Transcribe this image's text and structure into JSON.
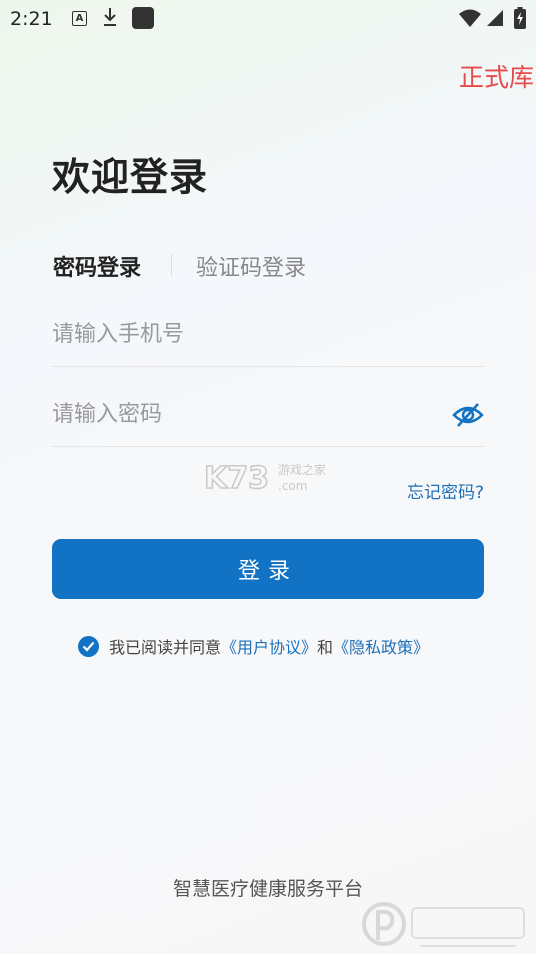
{
  "status_bar": {
    "time": "2:21",
    "icons": [
      "text-a-icon",
      "download-icon",
      "app-square-icon",
      "wifi-icon",
      "signal-icon",
      "battery-icon"
    ]
  },
  "env_label": "正式库",
  "title": "欢迎登录",
  "tabs": {
    "password": "密码登录",
    "sms": "验证码登录"
  },
  "phone_field": {
    "placeholder": "请输入手机号",
    "value": ""
  },
  "password_field": {
    "placeholder": "请输入密码",
    "value": ""
  },
  "forgot_password": "忘记密码?",
  "login_button": "登录",
  "agreement": {
    "checked": true,
    "text": "我已阅读并同意",
    "user_agreement": "《用户协议》",
    "and": "和",
    "privacy_policy": "《隐私政策》"
  },
  "footer": "智慧医疗健康服务平台",
  "colors": {
    "accent": "#1273c4",
    "link": "#1f6fb8",
    "env_label": "#e84b4b"
  }
}
